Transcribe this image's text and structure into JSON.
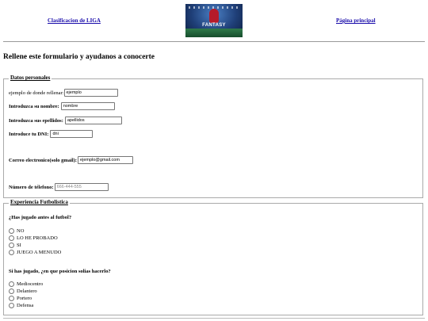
{
  "header": {
    "left_link": "Clasificacion de LIGA",
    "right_link": "Página principal",
    "logo_text": "FANTASY"
  },
  "intro": "Rellene este formulario y ayudanos a conocerte",
  "personal": {
    "legend": "Datos personales",
    "example_label": "ejemplo de donde rellenar:",
    "example_value": "ejemplo",
    "name_label": "Introduzca su nombre:",
    "name_value": "nombre",
    "surname_label": "Introduzca sus epellidos:",
    "surname_value": "apellidos",
    "dni_label": "Introduce tu DNI:",
    "dni_value": "dni",
    "email_label": "Correo electronico(solo gmail):",
    "email_value": "ejemplo@gmail.com",
    "phone_label": "Número de télefono:",
    "phone_placeholder": "666-444-555"
  },
  "football": {
    "legend": "Experiencia Futbolistica",
    "q1": "¿Has jugado antes al futbol?",
    "q1_options": [
      "NO",
      "LO HE PROBADO",
      "SI",
      "JUEGO A MENUDO"
    ],
    "q2": "Si has jugado, ¿en que posicion solias hacerlo?",
    "q2_options": [
      "Mediocentro",
      "Delantero",
      "Portero",
      "Defensa"
    ]
  }
}
